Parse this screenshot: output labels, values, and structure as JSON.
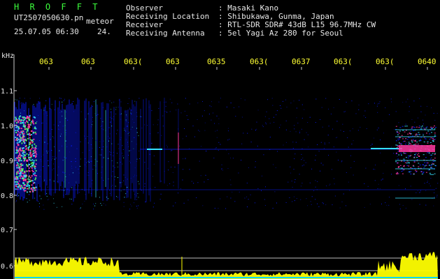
{
  "header": {
    "program": "H R O F F T",
    "filename": "UT2507050630.pn",
    "label": "meteor",
    "datetime": "25.07.05 06:30",
    "count": "24.",
    "fields": [
      {
        "label": "Observer",
        "value": ": Masaki Kano"
      },
      {
        "label": "Receiving Location",
        "value": ": Shibukawa, Gunma, Japan"
      },
      {
        "label": "Receiver",
        "value": ": RTL-SDR SDR# 43dB L15 96.7MHz CW"
      },
      {
        "label": "Receiving Antenna",
        "value": ": 5el Yagi Az 280 for Seoul"
      }
    ]
  },
  "axis": {
    "unit": "kHz",
    "y_ticks": [
      "1.1",
      "1.0",
      "0.9",
      "0.8",
      "0.7",
      "0.6"
    ],
    "x_ticks": [
      "063",
      "063",
      "063(",
      "063",
      "0635",
      "063(",
      "0637",
      "063(",
      "063(",
      "0640"
    ]
  },
  "colors": {
    "background": "#000000",
    "axis": "#cccccc",
    "tick_label": "#ffff33",
    "signal_low": "#0a1cff",
    "signal_mid": "#35e0ff",
    "signal_high": "#ff3aa0",
    "level_bar": "#ffff00",
    "baseline": "#00d8ff"
  }
}
